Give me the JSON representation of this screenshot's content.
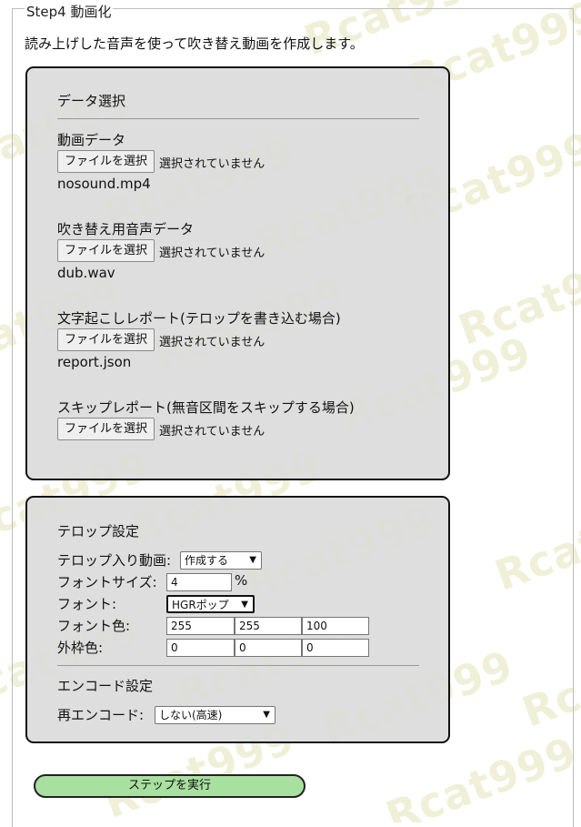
{
  "watermark": {
    "text": "Rcat999"
  },
  "step": {
    "legend": "Step4 動画化",
    "intro": "読み上げした音声を使って吹き替え動画を作成します。"
  },
  "data_panel": {
    "title": "データ選択",
    "file_button_label": "ファイルを選択",
    "no_file_text": "選択されていません",
    "fields": [
      {
        "label": "動画データ",
        "filename": "nosound.mp4"
      },
      {
        "label": "吹き替え用音声データ",
        "filename": "dub.wav"
      },
      {
        "label": "文字起こしレポート(テロップを書き込む場合)",
        "filename": "report.json"
      },
      {
        "label": "スキップレポート(無音区間をスキップする場合)",
        "filename": ""
      }
    ]
  },
  "settings_panel": {
    "telop_title": "テロップ設定",
    "telop_video_label": "テロップ入り動画:",
    "telop_video_value": "作成する",
    "font_size_label": "フォントサイズ:",
    "font_size_value": "4",
    "font_size_unit": "%",
    "font_label": "フォント:",
    "font_value": "HGRポップ",
    "font_color_label": "フォント色:",
    "font_color": [
      "255",
      "255",
      "100"
    ],
    "outline_color_label": "外枠色:",
    "outline_color": [
      "0",
      "0",
      "0"
    ],
    "encode_title": "エンコード設定",
    "reencode_label": "再エンコード:",
    "reencode_value": "しない(高速)"
  },
  "run_button_label": "ステップを実行",
  "colors": {
    "panel_bg": "#d9d9d9",
    "run_button_bg": "#a8e0a0",
    "watermark": "#dedeaa"
  }
}
